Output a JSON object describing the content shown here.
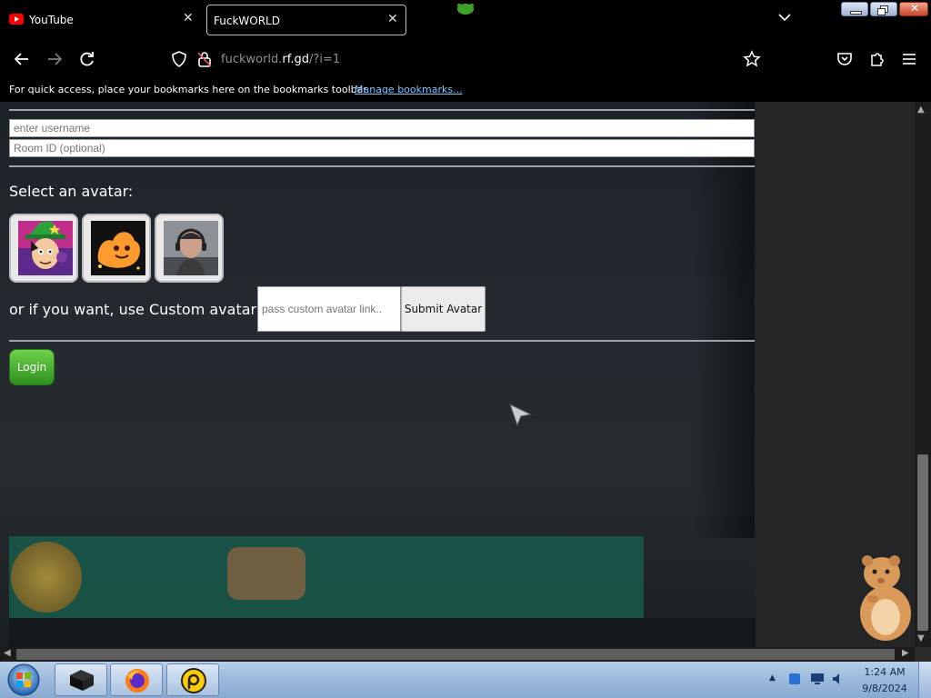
{
  "browser": {
    "tabs": [
      {
        "title": "YouTube",
        "active": false
      },
      {
        "title": "FuckWORLD",
        "active": true
      }
    ],
    "address": {
      "host": "fuckworld.",
      "domain": "rf.gd",
      "path": "/?i=1"
    },
    "bookmarks_bar": {
      "message": "For quick access, place your bookmarks here on the bookmarks toolbar.",
      "link": "Manage bookmarks..."
    }
  },
  "form": {
    "username_placeholder": "enter username",
    "room_placeholder": "Room ID (optional)",
    "avatar_heading": "Select an avatar:",
    "avatars": [
      "witch-avatar",
      "orange-blob-avatar",
      "photo-avatar"
    ],
    "custom_label": "or if you want, use Custom avatar URL",
    "custom_placeholder": "pass custom avatar link..",
    "submit_label": "Submit Avatar",
    "login_label": "Login"
  },
  "taskbar": {
    "time": "1:24 AM",
    "date": "9/8/2024"
  },
  "colors": {
    "accent_green": "#3fa12a",
    "youtube_red": "#ff0000",
    "link_blue": "#7cc4ff"
  }
}
